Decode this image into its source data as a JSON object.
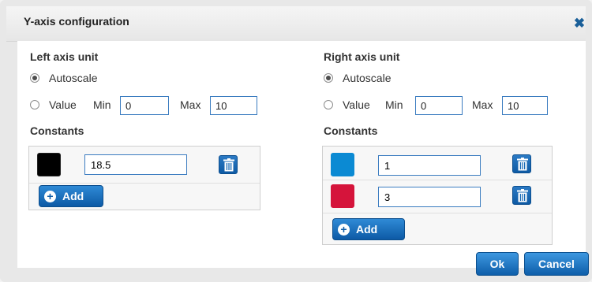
{
  "dialog": {
    "title": "Y-axis configuration",
    "close_icon": "close-icon",
    "ok_label": "Ok",
    "cancel_label": "Cancel"
  },
  "left": {
    "heading": "Left axis unit",
    "autoscale_label": "Autoscale",
    "value_label": "Value",
    "min_label": "Min",
    "min_value": "0",
    "max_label": "Max",
    "max_value": "10",
    "constants_heading": "Constants",
    "constants": [
      {
        "color": "#000000",
        "value": "18.5"
      }
    ],
    "add_label": "Add"
  },
  "right": {
    "heading": "Right axis unit",
    "autoscale_label": "Autoscale",
    "value_label": "Value",
    "min_label": "Min",
    "min_value": "0",
    "max_label": "Max",
    "max_value": "10",
    "constants_heading": "Constants",
    "constants": [
      {
        "color": "#0b8ad3",
        "value": "1"
      },
      {
        "color": "#d5143b",
        "value": "3"
      }
    ],
    "add_label": "Add"
  }
}
